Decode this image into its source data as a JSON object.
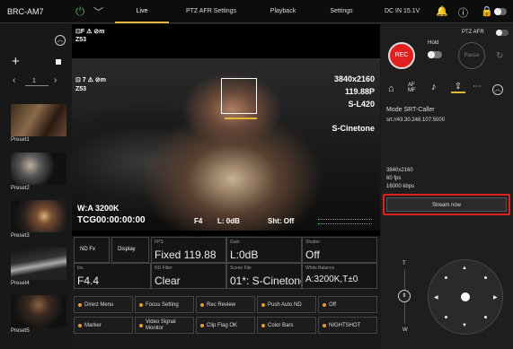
{
  "header": {
    "model": "BRC-AM7",
    "tabs": [
      "Live",
      "PTZ AFR Settings",
      "Playback",
      "Settings"
    ],
    "status": "DC IN 15.1V"
  },
  "left": {
    "page": "1",
    "presets": [
      "Preset1",
      "Preset2",
      "Preset3",
      "Preset4",
      "Preset5"
    ]
  },
  "video": {
    "top_left_1": "⊡F ⚠ ⊘m",
    "top_left_2": "Z53",
    "ov_left_1": "⊡ 7 ⚠ ⊘m",
    "ov_left_2": "Z53",
    "resolution": "3840x2160",
    "framerate": "119.88P",
    "loglevel": "S-L420",
    "cinetone": "S-Cinetone",
    "wb": "W:A  3200K",
    "tc": "TCG00:00:00:00",
    "iris": "F4",
    "level": "L: 0dB",
    "shutter": "Sht: Off"
  },
  "grid": {
    "ndfx": "ND Fx",
    "display": "Display",
    "fps_t": "FPS",
    "fps_v": "Fixed 119.88",
    "gain_t": "Gain",
    "gain_v": "L:0dB",
    "shutter_t": "Shutter",
    "shutter_v": "Off",
    "iris_t": "Iris",
    "iris_v": "F4.4",
    "nd_t": "ND Filter",
    "nd_v": "Clear",
    "scene_t": "Scene File",
    "scene_v": "01*: S-Cinetone",
    "wb_t": "White Balance",
    "wb_v": "A:3200K,T±0"
  },
  "buttons": [
    "Direct Menu",
    "Focus Setting",
    "Rec Review",
    "Push Auto ND",
    "Off",
    "Marker",
    "Video Signal Monitor",
    "Clip Flag OK",
    "Color Bars",
    "NIGHTSHOT"
  ],
  "right": {
    "hold": "Hold",
    "ptz_afr": "PTZ AFR",
    "rec": "REC",
    "pause": "Pause",
    "mode": "Mode  SRT-Caller",
    "srt": "srt://43.30.248.107:5000",
    "res": "3840x2160",
    "fps": "60 fps",
    "kbps": "16000 kbps",
    "stream": "Stream now",
    "t": "T",
    "w": "W"
  }
}
